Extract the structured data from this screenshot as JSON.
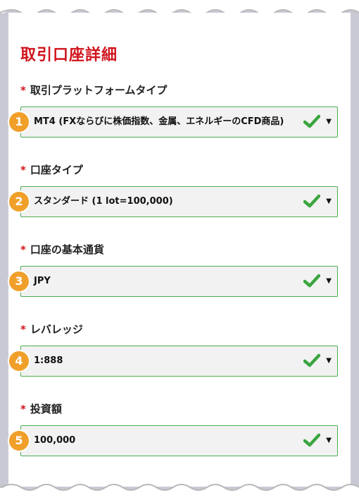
{
  "form": {
    "title": "取引口座詳細",
    "required_mark": "*",
    "fields": [
      {
        "number": "1",
        "label": "取引プラットフォームタイプ",
        "value": "MT4 (FXならびに株価指数、金属、エネルギーのCFD商品)"
      },
      {
        "number": "2",
        "label": "口座タイプ",
        "value": "スタンダード (1 lot=100,000)"
      },
      {
        "number": "3",
        "label": "口座の基本通貨",
        "value": "JPY"
      },
      {
        "number": "4",
        "label": "レバレッジ",
        "value": "1:888"
      },
      {
        "number": "5",
        "label": "投資額",
        "value": "100,000"
      }
    ]
  },
  "colors": {
    "title": "#d0141c",
    "badge": "#f0a02a",
    "valid_border": "#4caf50",
    "check": "#3aa53f"
  },
  "icons": {
    "valid": "check-icon",
    "dropdown": "caret-down-icon"
  }
}
